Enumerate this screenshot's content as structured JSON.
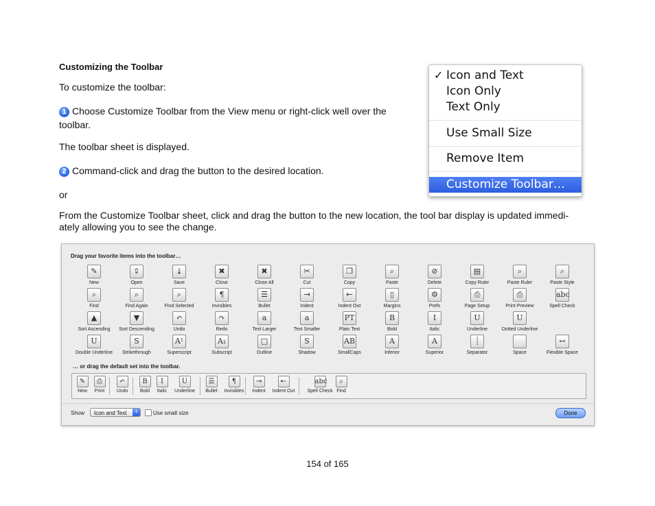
{
  "doc": {
    "heading": "Customizing the Toolbar",
    "intro": "To customize the toolbar:",
    "step1_badge": "1",
    "step1": "Choose Customize Toolbar from the View menu or right-click well over the",
    "step1_cont": "toolbar.",
    "sheet_shown": "The toolbar sheet is displayed.",
    "step2_badge": "2",
    "step2": "Command-click and drag the button to the desired location.",
    "or": "or",
    "para_line1": "From the Customize Toolbar sheet, click and drag the button to the new location, the tool bar display is updated immedi-",
    "para_line2": "ately allowing you to see the change.",
    "page_number": "154 of 165"
  },
  "menu": {
    "check": "✓",
    "icon_and_text": "Icon and Text",
    "icon_only": "Icon Only",
    "text_only": "Text Only",
    "use_small_size": "Use Small Size",
    "remove_item": "Remove Item",
    "customize_toolbar": "Customize Toolbar…"
  },
  "sheet": {
    "drag_label": "Drag your favorite items into the toolbar…",
    "default_label": "… or drag the default set into the toolbar.",
    "items": [
      {
        "label": "New",
        "glyph": "✎"
      },
      {
        "label": "Open",
        "glyph": "⇪"
      },
      {
        "label": "Save",
        "glyph": "⤓"
      },
      {
        "label": "Close",
        "glyph": "✖"
      },
      {
        "label": "Close All",
        "glyph": "✖"
      },
      {
        "label": "Cut",
        "glyph": "✂"
      },
      {
        "label": "Copy",
        "glyph": "❐"
      },
      {
        "label": "Paste",
        "glyph": "⌕"
      },
      {
        "label": "Delete",
        "glyph": "⊘"
      },
      {
        "label": "Copy Ruler",
        "glyph": "▤"
      },
      {
        "label": "Paste Ruler",
        "glyph": "⌕"
      },
      {
        "label": "Paste Style",
        "glyph": "⌕"
      },
      {
        "label": "Find",
        "glyph": "⌕"
      },
      {
        "label": "Find Again",
        "glyph": "⌕"
      },
      {
        "label": "Find Selected",
        "glyph": "⌕"
      },
      {
        "label": "Invisibles",
        "glyph": "¶"
      },
      {
        "label": "Bullet",
        "glyph": "☰"
      },
      {
        "label": "Indent",
        "glyph": "⇥"
      },
      {
        "label": "Indent Out",
        "glyph": "⇤"
      },
      {
        "label": "Margins",
        "glyph": "▯"
      },
      {
        "label": "Prefs",
        "glyph": "⚙"
      },
      {
        "label": "Page Setup",
        "glyph": "⎙"
      },
      {
        "label": "Print Preview",
        "glyph": "⎙"
      },
      {
        "label": "Spell Check",
        "glyph": "abc"
      },
      {
        "label": "Sort Ascending",
        "glyph": "▲"
      },
      {
        "label": "Sort Descending",
        "glyph": "▼"
      },
      {
        "label": "Undo",
        "glyph": "↶"
      },
      {
        "label": "Redo",
        "glyph": "↷"
      },
      {
        "label": "Text Larger",
        "glyph": "a"
      },
      {
        "label": "Text Smaller",
        "glyph": "a"
      },
      {
        "label": "Plain Text",
        "glyph": "PT"
      },
      {
        "label": "Bold",
        "glyph": "B"
      },
      {
        "label": "Italic",
        "glyph": "I"
      },
      {
        "label": "Underline",
        "glyph": "U"
      },
      {
        "label": "Dotted Underline",
        "glyph": "U"
      },
      {
        "label": "Double Underline",
        "glyph": "U"
      },
      {
        "label": "Strikethrough",
        "glyph": "S"
      },
      {
        "label": "Superscript",
        "glyph": "A¹"
      },
      {
        "label": "Subscript",
        "glyph": "A₁"
      },
      {
        "label": "Outline",
        "glyph": "□"
      },
      {
        "label": "Shadow",
        "glyph": "S"
      },
      {
        "label": "SmallCaps",
        "glyph": "AB"
      },
      {
        "label": "Inferior",
        "glyph": "A"
      },
      {
        "label": "Superior",
        "glyph": "A"
      },
      {
        "label": "Separator",
        "glyph": "┊"
      },
      {
        "label": "Space",
        "glyph": ""
      },
      {
        "label": "Flexible Space",
        "glyph": "↔"
      }
    ],
    "default_items": [
      {
        "label": "New",
        "glyph": "✎"
      },
      {
        "label": "Print",
        "glyph": "⎙"
      },
      {
        "label": "Undo",
        "glyph": "↶"
      },
      {
        "label": "Bold",
        "glyph": "B"
      },
      {
        "label": "Italic",
        "glyph": "I"
      },
      {
        "label": "Underline",
        "glyph": "U"
      },
      {
        "label": "Bullet",
        "glyph": "☰"
      },
      {
        "label": "Invisibles",
        "glyph": "¶"
      },
      {
        "label": "Indent",
        "glyph": "⇥"
      },
      {
        "label": "Indent Out",
        "glyph": "⇤"
      },
      {
        "label": "Spell Check",
        "glyph": "abc"
      },
      {
        "label": "Find",
        "glyph": "⌕"
      }
    ],
    "show_label": "Show",
    "show_value": "Icon and Text",
    "small_size_label": "Use small size",
    "done_label": "Done"
  }
}
